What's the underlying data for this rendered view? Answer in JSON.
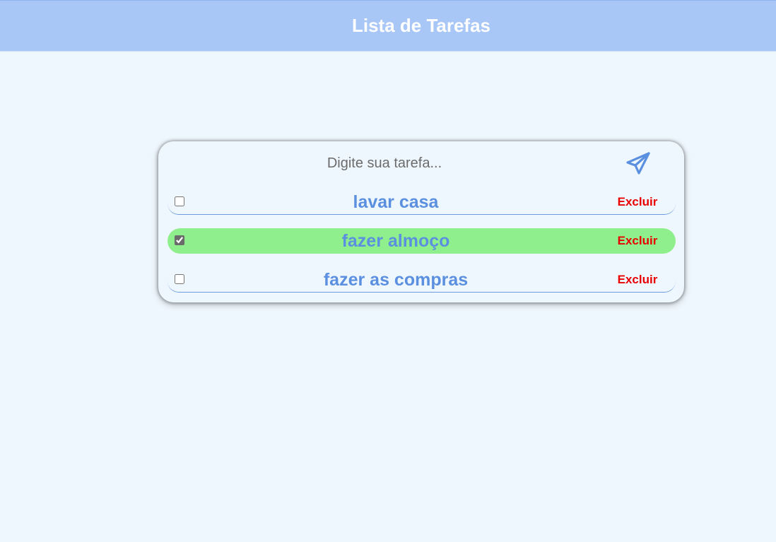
{
  "header": {
    "title": "Lista de Tarefas",
    "background": "#a8c7f7"
  },
  "form": {
    "placeholder": "Digite sua tarefa...",
    "value": "",
    "send_icon": "paper-plane-icon"
  },
  "tasks": [
    {
      "text": "lavar casa",
      "done": false,
      "delete_label": "Excluir"
    },
    {
      "text": "fazer almoço",
      "done": true,
      "delete_label": "Excluir"
    },
    {
      "text": "fazer as compras",
      "done": false,
      "delete_label": "Excluir"
    }
  ],
  "colors": {
    "page_background": "#eff7fe",
    "task_text": "#5b8fdf",
    "done_background": "#90ef8d",
    "delete_text": "#e80000"
  }
}
